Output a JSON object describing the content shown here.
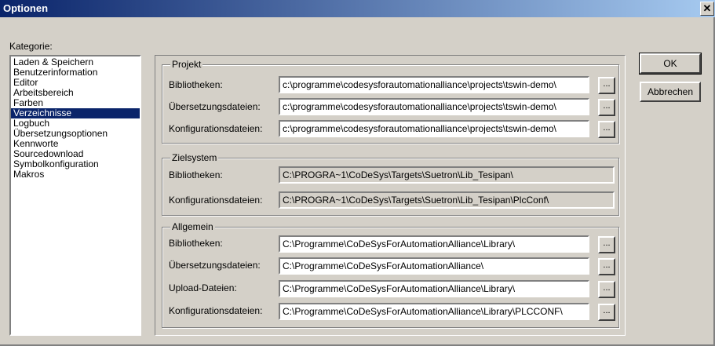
{
  "window": {
    "title": "Optionen",
    "close": "✕"
  },
  "categories": {
    "label": "Kategorie:",
    "items": [
      "Laden & Speichern",
      "Benutzerinformation",
      "Editor",
      "Arbeitsbereich",
      "Farben",
      "Verzeichnisse",
      "Logbuch",
      "Übersetzungsoptionen",
      "Kennworte",
      "Sourcedownload",
      "Symbolkonfiguration",
      "Makros"
    ],
    "selected_index": 5
  },
  "projekt": {
    "title": "Projekt",
    "rows": [
      {
        "label": "Bibliotheken:",
        "value": "c:\\programme\\codesysforautomationalliance\\projects\\tswin-demo\\"
      },
      {
        "label": "Übersetzungsdateien:",
        "value": "c:\\programme\\codesysforautomationalliance\\projects\\tswin-demo\\"
      },
      {
        "label": "Konfigurationsdateien:",
        "value": "c:\\programme\\codesysforautomationalliance\\projects\\tswin-demo\\"
      }
    ]
  },
  "zielsystem": {
    "title": "Zielsystem",
    "rows": [
      {
        "label": "Bibliotheken:",
        "value": "C:\\PROGRA~1\\CoDeSys\\Targets\\Suetron\\Lib_Tesipan\\"
      },
      {
        "label": "Konfigurationsdateien:",
        "value": "C:\\PROGRA~1\\CoDeSys\\Targets\\Suetron\\Lib_Tesipan\\PlcConf\\"
      }
    ]
  },
  "allgemein": {
    "title": "Allgemein",
    "rows": [
      {
        "label": "Bibliotheken:",
        "value": "C:\\Programme\\CoDeSysForAutomationAlliance\\Library\\"
      },
      {
        "label": "Übersetzungsdateien:",
        "value": "C:\\Programme\\CoDeSysForAutomationAlliance\\"
      },
      {
        "label": "Upload-Dateien:",
        "value": "C:\\Programme\\CoDeSysForAutomationAlliance\\Library\\"
      },
      {
        "label": "Konfigurationsdateien:",
        "value": "C:\\Programme\\CoDeSysForAutomationAlliance\\Library\\PLCCONF\\"
      }
    ]
  },
  "browse_label": "...",
  "buttons": {
    "ok": "OK",
    "cancel": "Abbrechen"
  }
}
